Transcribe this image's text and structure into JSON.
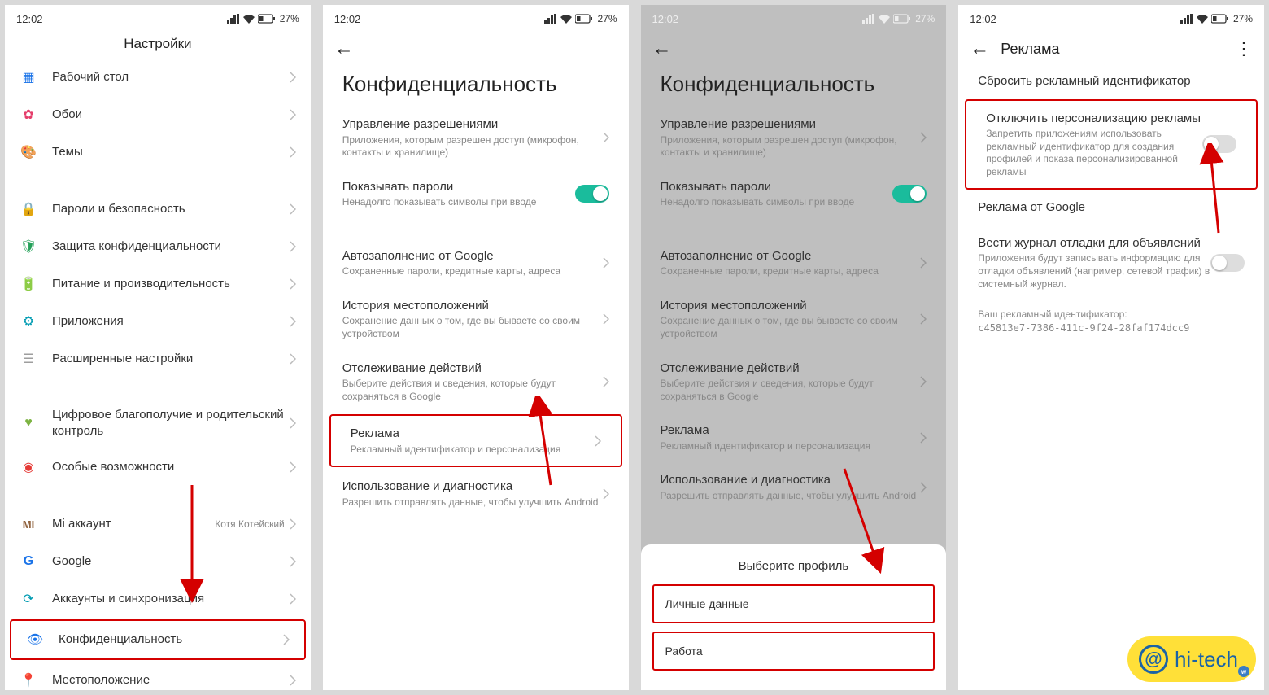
{
  "status": {
    "time": "12:02",
    "battery_pct": "27%"
  },
  "panel1": {
    "title": "Настройки",
    "items": [
      {
        "icon": "grid-icon",
        "color": "#1a73e8",
        "label": "Рабочий стол"
      },
      {
        "icon": "wallpaper-icon",
        "color": "#e53e6b",
        "label": "Обои"
      },
      {
        "icon": "theme-icon",
        "color": "#e67e22",
        "label": "Темы"
      }
    ],
    "items2": [
      {
        "icon": "lock-icon",
        "color": "#1a73e8",
        "label": "Пароли и безопасность"
      },
      {
        "icon": "shield-icon",
        "color": "#25a15a",
        "label": "Защита конфиденциальности"
      },
      {
        "icon": "battery-icon",
        "color": "#30c181",
        "label": "Питание и производительность"
      },
      {
        "icon": "apps-icon",
        "color": "#009bb2",
        "label": "Приложения"
      },
      {
        "icon": "sliders-icon",
        "color": "#9e9e9e",
        "label": "Расширенные настройки"
      }
    ],
    "items3": [
      {
        "icon": "wellbeing-icon",
        "color": "#7cb342",
        "label": "Цифровое благополучие и родительский контроль"
      },
      {
        "icon": "accessibility-icon",
        "color": "#e53935",
        "label": "Особые возможности"
      }
    ],
    "items4": [
      {
        "icon": "mi-icon",
        "color": "#8e5f3a",
        "label": "Mi аккаунт",
        "value": "Котя Котейский"
      },
      {
        "icon": "google-icon",
        "color": "#1a73e8",
        "label": "Google"
      },
      {
        "icon": "sync-icon",
        "color": "#009bb2",
        "label": "Аккаунты и синхронизация"
      },
      {
        "icon": "eye-icon",
        "color": "#1a73e8",
        "label": "Конфиденциальность",
        "highlight": true
      },
      {
        "icon": "location-icon",
        "color": "#f39c12",
        "label": "Местоположение"
      }
    ]
  },
  "panel2": {
    "title": "Конфиденциальность",
    "rows": [
      {
        "title": "Управление разрешениями",
        "sub": "Приложения, которым разрешен доступ (микрофон, контакты и хранилище)",
        "chevron": true
      },
      {
        "title": "Показывать пароли",
        "sub": "Ненадолго показывать символы при вводе",
        "toggle": "on"
      }
    ],
    "rows2": [
      {
        "title": "Автозаполнение от Google",
        "sub": "Сохраненные пароли, кредитные карты, адреса",
        "chevron": true
      },
      {
        "title": "История местоположений",
        "sub": "Сохранение данных о том, где вы бываете со своим устройством",
        "chevron": true
      },
      {
        "title": "Отслеживание действий",
        "sub": "Выберите действия и сведения, которые будут сохраняться в Google",
        "chevron": true
      },
      {
        "title": "Реклама",
        "sub": "Рекламный идентификатор и персонализация",
        "chevron": true,
        "highlight": true
      },
      {
        "title": "Использование и диагностика",
        "sub": "Разрешить отправлять данные, чтобы улучшить Android",
        "chevron": true
      }
    ]
  },
  "panel3": {
    "sheet_title": "Выберите профиль",
    "sheet_opts": [
      "Личные данные",
      "Работа"
    ]
  },
  "panel4": {
    "title": "Реклама",
    "reset": "Сбросить рекламный идентификатор",
    "opt_out": {
      "title": "Отключить персонализацию рекламы",
      "sub": "Запретить приложениям использовать рекламный идентификатор для создания профилей и показа персонализированной рекламы",
      "toggle": "off"
    },
    "google_ads": "Реклама от Google",
    "debug": {
      "title": "Вести журнал отладки для объявлений",
      "sub": "Приложения будут записывать информацию для отладки объявлений (например, сетевой трафик) в системный журнал.",
      "toggle": "off"
    },
    "id_label": "Ваш рекламный идентификатор:",
    "id_value": "c45813e7-7386-411c-9f24-28faf174dcc9"
  },
  "watermark": "hi-tech"
}
